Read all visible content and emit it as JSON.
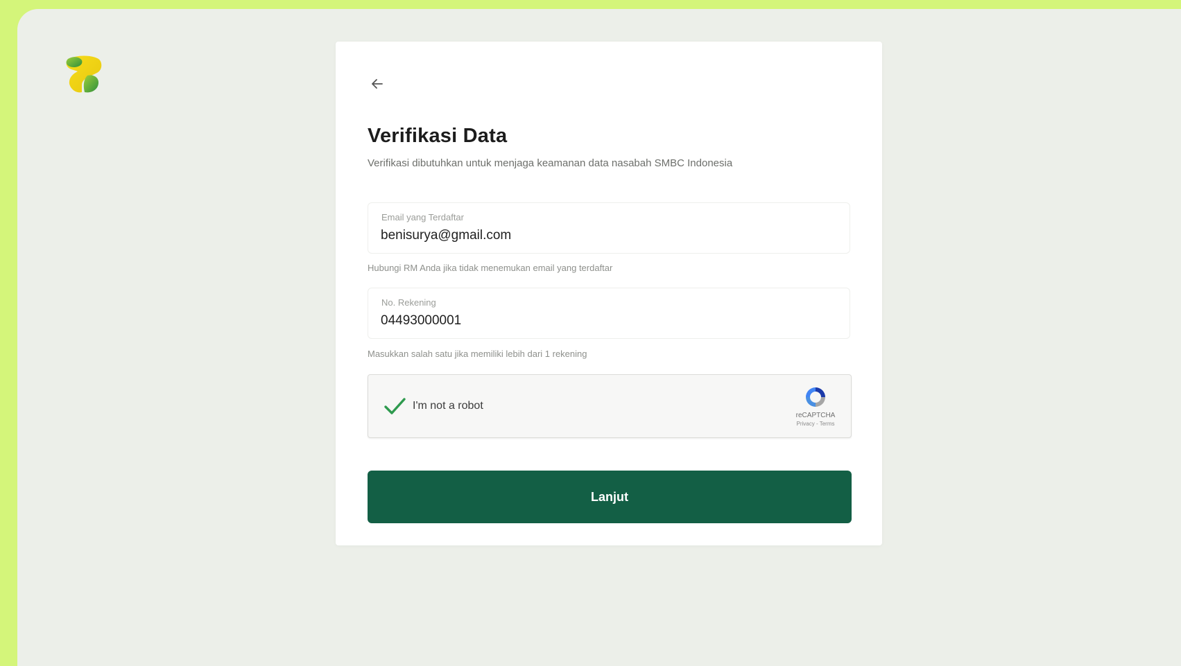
{
  "brand": {
    "logo_icon": "brand-logo-icon",
    "colors": {
      "page_background": "#d4f57a",
      "frame_background": "#ecefe9",
      "primary": "#135f45",
      "logo_yellow": "#f3d314",
      "logo_green": "#55b84a"
    }
  },
  "card": {
    "back_icon": "arrow-left-icon",
    "title": "Verifikasi Data",
    "subtitle": "Verifikasi dibutuhkan untuk menjaga keamanan data nasabah SMBC Indonesia"
  },
  "email_field": {
    "label": "Email yang Terdaftar",
    "value": "benisurya@gmail.com",
    "helper": "Hubungi RM Anda jika tidak menemukan email yang terdaftar"
  },
  "account_field": {
    "label": "No. Rekening",
    "value": "04493000001",
    "helper": "Masukkan salah satu jika memiliki lebih dari 1 rekening"
  },
  "captcha": {
    "checked": true,
    "check_icon": "checkmark-icon",
    "label": "I'm not a robot",
    "brand": "reCAPTCHA",
    "links": "Privacy - Terms",
    "logo_icon": "recaptcha-logo-icon"
  },
  "actions": {
    "submit_label": "Lanjut"
  }
}
